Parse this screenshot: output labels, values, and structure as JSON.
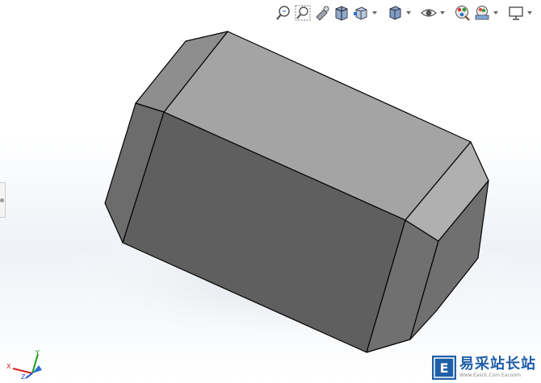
{
  "toolbar": {
    "items": [
      {
        "icon": "zoom-to-fit-icon"
      },
      {
        "icon": "zoom-to-area-icon"
      },
      {
        "icon": "previous-view-icon"
      },
      {
        "icon": "section-view-icon"
      },
      {
        "icon": "view-orientation-icon",
        "has_dropdown": true
      },
      {
        "icon": "display-style-icon",
        "has_dropdown": true
      },
      {
        "icon": "hide-show-items-icon",
        "has_dropdown": true
      },
      {
        "icon": "edit-appearance-icon"
      },
      {
        "icon": "apply-scene-icon",
        "has_dropdown": true
      },
      {
        "icon": "view-settings-icon",
        "has_dropdown": true
      }
    ]
  },
  "model": {
    "colors": {
      "top_face": "#a4a4a4",
      "front_face": "#5f5f5f",
      "left_bevel": "#6c6c6c",
      "left_top_bevel": "#8e8e8e",
      "right_bevel": "#707070",
      "right_top_bevel": "#b0b0b0",
      "edge_line": "#000000"
    }
  },
  "triad": {
    "x_label": "X",
    "y_label": "Y",
    "z_label": "Z",
    "colors": {
      "x": "#d62020",
      "y": "#1a9a1a",
      "z": "#1a4fd6"
    }
  },
  "watermark": {
    "title": "易采站长站",
    "url": "Www.Easck.Com Eacoom",
    "logo_letter": "E",
    "color": "#1f5fa8"
  }
}
